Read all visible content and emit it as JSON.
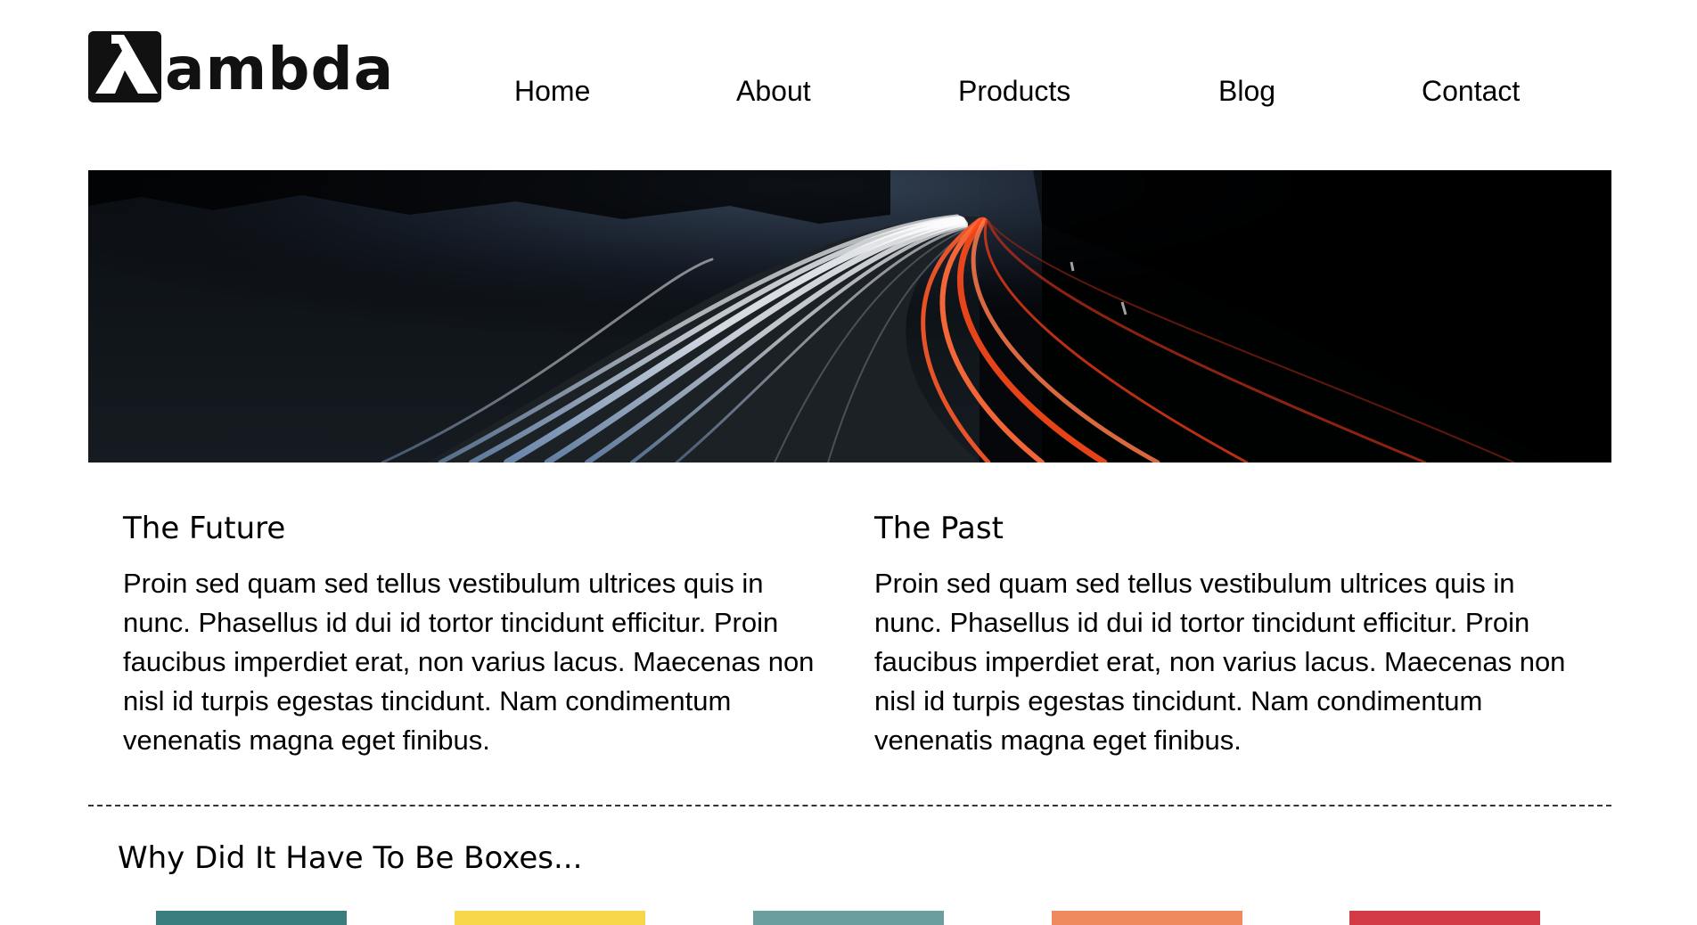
{
  "header": {
    "logo_text": "ambda",
    "nav": [
      "Home",
      "About",
      "Products",
      "Blog",
      "Contact"
    ]
  },
  "hero": {
    "image": "night-highway-light-trails"
  },
  "columns": [
    {
      "title": "The Future",
      "body": "Proin sed quam sed tellus vestibulum ultrices quis in nunc. Phasellus id dui id tortor tincidunt efficitur. Proin faucibus imperdiet erat, non varius lacus. Maecenas non nisl id turpis egestas tincidunt. Nam condimentum venenatis magna eget finibus."
    },
    {
      "title": "The Past",
      "body": "Proin sed quam sed tellus vestibulum ultrices quis in nunc. Phasellus id dui id tortor tincidunt efficitur. Proin faucibus imperdiet erat, non varius lacus. Maecenas non nisl id turpis egestas tincidunt. Nam condimentum venenatis magna eget finibus."
    }
  ],
  "boxes": {
    "title": "Why Did It Have To Be Boxes...",
    "colors": [
      "#3a7d7e",
      "#f8d84a",
      "#6b9e9f",
      "#ef8a5e",
      "#d23a45"
    ]
  },
  "colors": {
    "text": "#000000",
    "background": "#ffffff",
    "logo_dark": "#111111"
  }
}
